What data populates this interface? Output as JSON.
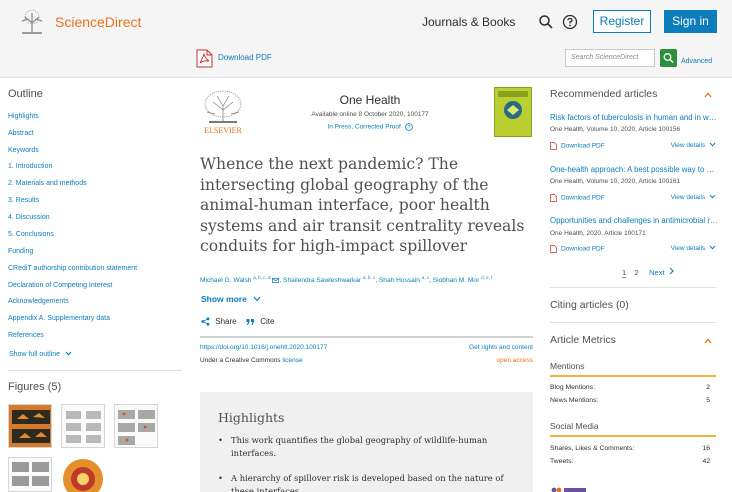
{
  "header": {
    "brand": "ScienceDirect",
    "nav_journals": "Journals & Books",
    "register": "Register",
    "sign_in": "Sign in",
    "download_pdf": "Download PDF",
    "search_placeholder": "Search ScienceDirect",
    "advanced": "Advanced"
  },
  "outline": {
    "title": "Outline",
    "items": [
      "Highlights",
      "Abstract",
      "Keywords",
      "1. Introduction",
      "2. Materials and methods",
      "3. Results",
      "4. Discussion",
      "5. Conclusions",
      "Funding",
      "CRediT authorship contribution statement",
      "Declaration of Competing Interest",
      "Acknowledgements",
      "Appendix A. Supplementary data",
      "References"
    ],
    "show_full": "Show full outline",
    "figures_title": "Figures (5)"
  },
  "article": {
    "journal": "One Health",
    "available": "Available online 8 October 2020, 100177",
    "in_press": "In Press, Corrected Proof",
    "publisher_logo_text": "ELSEVIER",
    "title": "Whence the next pandemic? The intersecting global geography of the animal-human interface, poor health systems and air transit centrality reveals conduits for high-impact spillover",
    "authors": [
      {
        "name": "Michael G. Walsh",
        "sup": "a, b, c, d"
      },
      {
        "name": "Shailendra Sawleshwarkar",
        "sup": "a, b, c"
      },
      {
        "name": "Shah Hossain",
        "sup": "a, c"
      },
      {
        "name": "Siobhan M. Mor",
        "sup": "d, e, f"
      }
    ],
    "show_more": "Show more",
    "share": "Share",
    "cite": "Cite",
    "doi": "https://doi.org/10.1016/j.onehlt.2020.100177",
    "license_prefix": "Under a Creative Commons ",
    "license_link": "license",
    "rights": "Get rights and content",
    "open_access": "open access",
    "highlights_title": "Highlights",
    "highlights": [
      "This work quantifies the global geography of wildlife-human interfaces.",
      "A hierarchy of spillover risk is developed based on the nature of these interfaces."
    ]
  },
  "recommended": {
    "title": "Recommended articles",
    "items": [
      {
        "title": "Risk factors of tuberculosis in human and in wildlife",
        "meta": "One Health, Volume 10, 2020, Article 100156",
        "pdf": "Download PDF",
        "view": "View details"
      },
      {
        "title": "One-health approach: A best possible way to control rabies",
        "meta": "One Health, Volume 10, 2020, Article 100161",
        "pdf": "Download PDF",
        "view": "View details"
      },
      {
        "title": "Opportunities and challenges in antimicrobial resistance",
        "meta": "One Health, 2020, Article 100171",
        "pdf": "Download PDF",
        "view": "View details"
      }
    ],
    "pager": {
      "current": "1",
      "next_page": "2",
      "next": "Next"
    }
  },
  "citing": {
    "title": "Citing articles (0)"
  },
  "metrics": {
    "title": "Article Metrics",
    "mentions_head": "Mentions",
    "blog_label": "Blog Mentions:",
    "blog_value": "2",
    "news_label": "News Mentions:",
    "news_value": "5",
    "social_head": "Social Media",
    "shares_label": "Shares, Likes & Comments:",
    "shares_value": "16",
    "tweets_label": "Tweets:",
    "tweets_value": "42"
  },
  "colors": {
    "brand_orange": "#e9711c",
    "link_blue": "#0c7dbb",
    "cover_green": "#b9cf32",
    "metric_bar": "#f4b338"
  }
}
